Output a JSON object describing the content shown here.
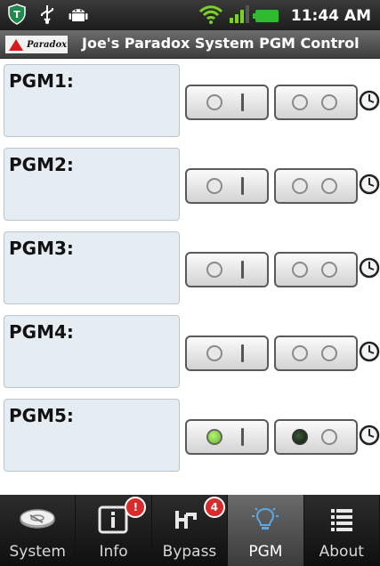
{
  "status_bar": {
    "time": "11:44 AM",
    "icons": [
      "shield-icon",
      "usb-icon",
      "android-icon",
      "wifi-icon",
      "signal-icon",
      "battery-icon"
    ]
  },
  "header": {
    "logo_text": "Paradox",
    "title": "Joe's Paradox System PGM Control"
  },
  "pgms": [
    {
      "label": "PGM1:",
      "on_active": false,
      "off_active": false
    },
    {
      "label": "PGM2:",
      "on_active": false,
      "off_active": false
    },
    {
      "label": "PGM3:",
      "on_active": false,
      "off_active": false
    },
    {
      "label": "PGM4:",
      "on_active": false,
      "off_active": false
    },
    {
      "label": "PGM5:",
      "on_active": true,
      "off_active": true
    }
  ],
  "nav": {
    "tabs": [
      {
        "label": "System",
        "icon": "disk-icon",
        "badge": ""
      },
      {
        "label": "Info",
        "icon": "info-icon",
        "badge": "!"
      },
      {
        "label": "Bypass",
        "icon": "bypass-icon",
        "badge": "4"
      },
      {
        "label": "PGM",
        "icon": "lightbulb-icon",
        "badge": ""
      },
      {
        "label": "About",
        "icon": "list-icon",
        "badge": ""
      }
    ],
    "active": "PGM"
  },
  "colors": {
    "status_bar": "#1c1c1c",
    "title_bar": "#4a4a4a",
    "name_box": "#e6edf2",
    "on_indicator": "#5fbf1e",
    "badge": "#d92b2b"
  }
}
